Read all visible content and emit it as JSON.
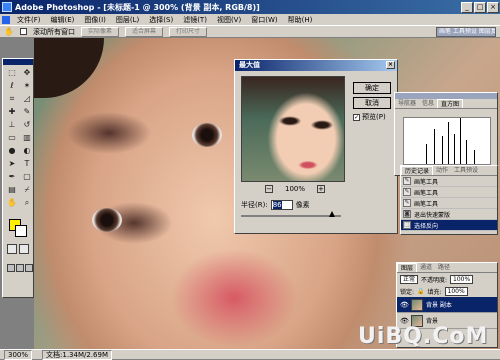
{
  "window": {
    "title": "Adobe Photoshop - [未标题-1 @ 300% (背景 副本, RGB/8)]"
  },
  "menu": {
    "items": [
      "文件(F)",
      "编辑(E)",
      "图像(I)",
      "图层(L)",
      "选择(S)",
      "滤镜(T)",
      "视图(V)",
      "窗口(W)",
      "帮助(H)"
    ]
  },
  "options": {
    "scroll_all_windows": "滚动所有窗口",
    "actual_pixels": "实际像素",
    "fit_on_screen": "适合屏幕",
    "print_size": "打印尺寸",
    "palette_well": "画笔 工具预设 图层复合"
  },
  "dialog": {
    "title": "最大值",
    "ok": "确定",
    "cancel": "取消",
    "preview_label": "预览(P)",
    "zoom": "100%",
    "zoom_minus": "−",
    "zoom_plus": "+",
    "radius_label": "半径(R):",
    "radius_value": "86",
    "radius_unit": "像素"
  },
  "histogram": {
    "tab_active": "直方图",
    "tab1": "导航器",
    "tab2": "信息"
  },
  "history": {
    "tabs": [
      "历史记录",
      "动作",
      "工具预设"
    ],
    "items": [
      {
        "label": "画笔工具",
        "selected": false
      },
      {
        "label": "画笔工具",
        "selected": false
      },
      {
        "label": "画笔工具",
        "selected": false
      },
      {
        "label": "退出快速蒙版",
        "selected": false
      },
      {
        "label": "选择反向",
        "selected": true
      }
    ]
  },
  "layers": {
    "tabs": [
      "图层",
      "通道",
      "路径"
    ],
    "blend_mode": "正常",
    "opacity_label": "不透明度:",
    "opacity": "100%",
    "lock_label": "锁定:",
    "fill_label": "填充:",
    "fill": "100%",
    "rows": [
      {
        "name": "背景 副本",
        "selected": true
      },
      {
        "name": "背景",
        "selected": false
      }
    ]
  },
  "status": {
    "zoom": "300%",
    "doc": "文档:1.34M/2.69M"
  },
  "watermark": "UiBQ.CoM",
  "colors": {
    "foreground": "#ffee00",
    "background": "#ffffff",
    "title_blue": "#0a246a"
  }
}
